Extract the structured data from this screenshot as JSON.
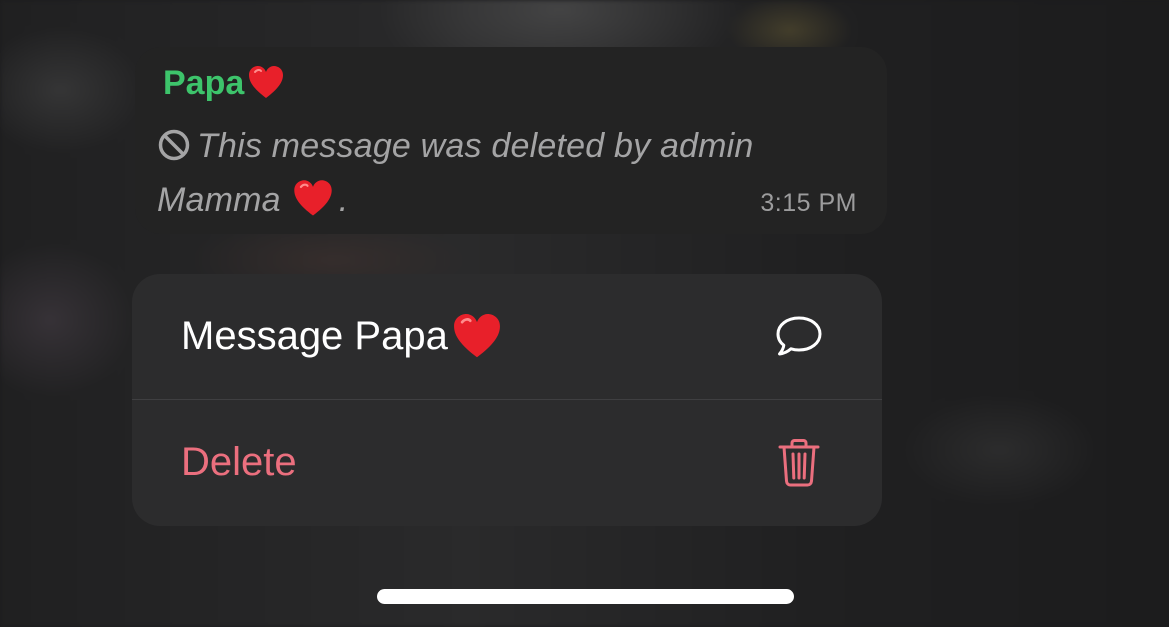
{
  "message": {
    "sender_name": "Papa",
    "sender_emoji": "red-heart",
    "deleted_text": "This message was deleted by admin Mamma",
    "deleted_suffix": ".",
    "time": "3:15 PM",
    "status_icon": "prohibited-icon"
  },
  "menu": {
    "items": [
      {
        "label": "Message Papa",
        "emoji": "red-heart",
        "icon": "chat-bubble-icon"
      },
      {
        "label": "Delete",
        "icon": "trash-icon",
        "style": "destructive"
      }
    ]
  },
  "colors": {
    "sender": "#3dc46b",
    "destructive": "#eb6f7e",
    "menu_bg": "#2c2c2d",
    "bubble_bg": "#232323"
  }
}
